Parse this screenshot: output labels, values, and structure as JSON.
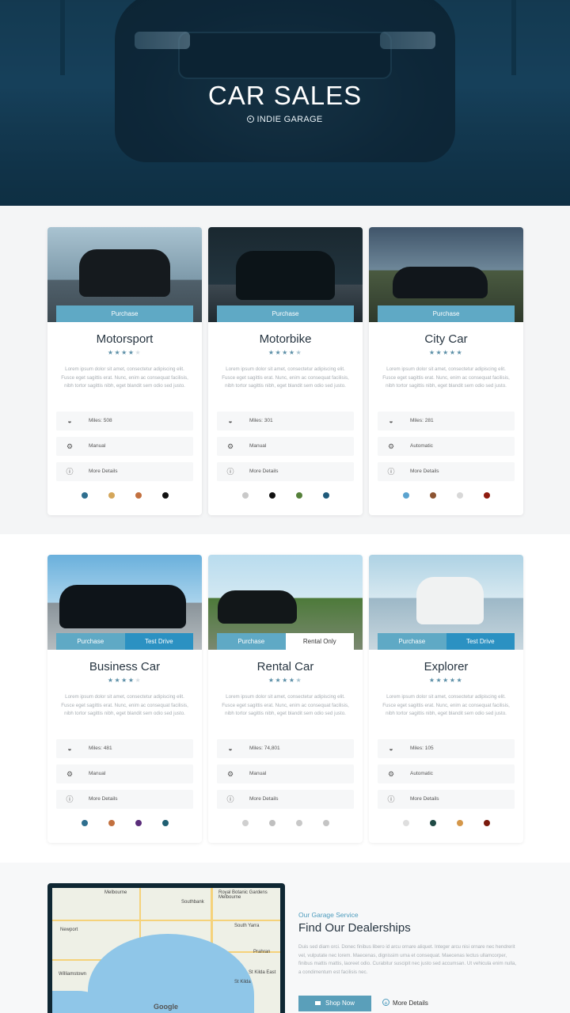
{
  "hero": {
    "title": "CAR SALES",
    "subtitle": "INDIE GARAGE",
    "icon": "location-icon"
  },
  "lorem": "Lorem ipsum dolor sit amet, consectetur adipiscing elit. Fusce eget sagittis erat. Nunc, enim ac consequat facilisis, nibh tortor sagittis nibh, eget blandit sem odio sed justo.",
  "cards": [
    {
      "title": "Motorsport",
      "rating": 4,
      "buttons": [
        "Purchase"
      ],
      "spec1": "Miles: 508",
      "spec2": "Manual",
      "spec3": "More Details",
      "colors": [
        "#2f6f8f",
        "#d4a65a",
        "#c2703f",
        "#111111"
      ]
    },
    {
      "title": "Motorbike",
      "rating": 4.5,
      "buttons": [
        "Purchase"
      ],
      "spec1": "Miles: 301",
      "spec2": "Manual",
      "spec3": "More Details",
      "colors": [
        "#c9c9c9",
        "#111111",
        "#55803a",
        "#1f5a7a"
      ]
    },
    {
      "title": "City Car",
      "rating": 5,
      "buttons": [
        "Purchase"
      ],
      "spec1": "Miles: 281",
      "spec2": "Automatic",
      "spec3": "More Details",
      "colors": [
        "#5ba3cf",
        "#8c5432",
        "#d8d8d8",
        "#8e1b0f"
      ]
    },
    {
      "title": "Business Car",
      "rating": 4,
      "buttons": [
        "Purchase",
        "Test Drive"
      ],
      "spec1": "Miles: 481",
      "spec2": "Manual",
      "spec3": "More Details",
      "colors": [
        "#2f6f8f",
        "#c2703f",
        "#5a2d7a",
        "#1f5f72"
      ]
    },
    {
      "title": "Rental Car",
      "rating": 4.5,
      "buttons": [
        "Purchase",
        "Rental Only"
      ],
      "spec1": "Miles: 74,801",
      "spec2": "Manual",
      "spec3": "More Details",
      "colors": [
        "#cfcfcf",
        "#bfbfbf",
        "#c8c8c8",
        "#c4c4c4"
      ]
    },
    {
      "title": "Explorer",
      "rating": 5,
      "buttons": [
        "Purchase",
        "Test Drive"
      ],
      "spec1": "Miles: 105",
      "spec2": "Automatic",
      "spec3": "More Details",
      "colors": [
        "#dedede",
        "#1f4a45",
        "#d4974a",
        "#7a1a0d"
      ]
    }
  ],
  "map": {
    "labels": [
      "Melbourne",
      "Newport",
      "Williamstown",
      "Southbank",
      "South Yarra",
      "Prahran",
      "St Kilda East",
      "St Kilda",
      "Royal Botanic Gardens Melbourne"
    ],
    "logo": "Google"
  },
  "dealer": {
    "kicker": "Our Garage Service",
    "title": "Find Our Dealerships",
    "text": "Duis sed diam orci. Donec finibus libero id arcu ornare aliquet. Integer arcu nisi ornare nec hendrerit vel, vulputate nec lorem. Maecenas, dignissim urna et consequat. Maecenas lectus ullamcorper, finibus mattis mattis, laoreet odio. Curabitur suscipit nec justo sed accumsan. Ut vehicula enim nulla, a condimentum est facilisis nec.",
    "shop": "Shop Now",
    "more": "More Details"
  }
}
